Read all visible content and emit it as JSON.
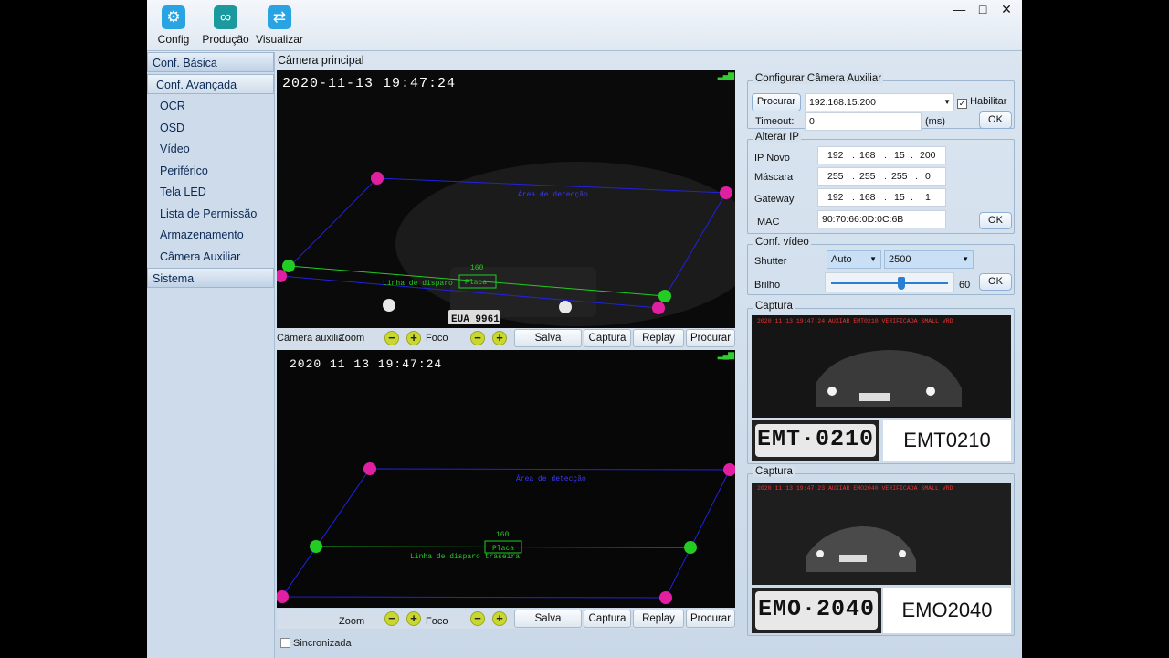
{
  "toolbar": {
    "config": "Config",
    "producao": "Produção",
    "visualizar": "Visualizar",
    "icons": [
      "gear-icon",
      "infinity-icon",
      "swap-arrows-icon"
    ]
  },
  "window_controls": {
    "minimize": "—",
    "maximize": "□",
    "close": "✕"
  },
  "sidebar": {
    "basic": "Conf. Básica",
    "advanced": "Conf. Avançada",
    "items": [
      "OCR",
      "OSD",
      "Vídeo",
      "Periférico",
      "Tela LED",
      "Lista de Permissão",
      "Armazenamento",
      "Câmera Auxiliar"
    ],
    "system": "Sistema"
  },
  "main": {
    "camera_title": "Câmera principal",
    "cam1": {
      "timestamp": "2020-11-13  19:47:24",
      "zone_label": "Área de detecção",
      "line_label": "Linha de disparo",
      "plate_box_label": "Placa",
      "width_label": "160",
      "plate_text": "EUA 9961"
    },
    "cam2": {
      "timestamp": "2020 11 13  19:47:24",
      "zone_label": "Área de detecção",
      "line_label": "Linha de disparo traseira",
      "plate_box_label": "Placa",
      "width_label": "160"
    },
    "ctrl1": {
      "aux_label": "Câmera auxilia",
      "zoom": "Zoom",
      "foco": "Foco",
      "salva": "Salva",
      "captura": "Captura",
      "replay": "Replay",
      "procurar": "Procurar"
    },
    "ctrl2": {
      "zoom": "Zoom",
      "foco": "Foco",
      "salva": "Salva",
      "captura": "Captura",
      "replay": "Replay",
      "procurar": "Procurar"
    },
    "minus": "−",
    "plus": "+",
    "sync_label": "Sincronizada"
  },
  "aux_camera": {
    "title": "Configurar Câmera Auxiliar",
    "procurar": "Procurar",
    "ip_value": "192.168.15.200",
    "habilitar": "Habilitar",
    "habilitar_checked": true,
    "timeout_label": "Timeout:",
    "timeout_value": "0",
    "timeout_unit": "(ms)",
    "ok": "OK"
  },
  "alterar_ip": {
    "title": "Alterar IP",
    "ip_label": "IP Novo",
    "ip": [
      "192",
      "168",
      "15",
      "200"
    ],
    "mask_label": "Máscara",
    "mask": [
      "255",
      "255",
      "255",
      "0"
    ],
    "gw_label": "Gateway",
    "gw": [
      "192",
      "168",
      "15",
      "1"
    ],
    "mac_label": "MAC",
    "mac": "90:70:66:0D:0C:6B",
    "ok": "OK"
  },
  "video": {
    "title": "Conf. vídeo",
    "shutter_label": "Shutter",
    "shutter_mode": "Auto",
    "shutter_value": "2500",
    "brilho_label": "Brilho",
    "brilho_value": "60",
    "brilho_fraction": 0.6,
    "ok": "OK"
  },
  "captures": [
    {
      "title": "Captura",
      "overlay": "2020 11 13 19:47:24  AUXIAR  EMT0210  VERIFICADA  SMALL VRD",
      "plate": "EMT·0210",
      "ocr": "EMT0210"
    },
    {
      "title": "Captura",
      "overlay": "2020 11 13 19:47:23  AUXIAR  EMO2040  VERIFICADA  SMALL VRD",
      "plate": "EMO·2040",
      "ocr": "EMO2040"
    }
  ],
  "colors": {
    "zone_line": "#2222dd",
    "trigger_line": "#22cc22",
    "point_magenta": "#e020a0",
    "point_green": "#22cc22",
    "accent": "#2aa3e3"
  }
}
